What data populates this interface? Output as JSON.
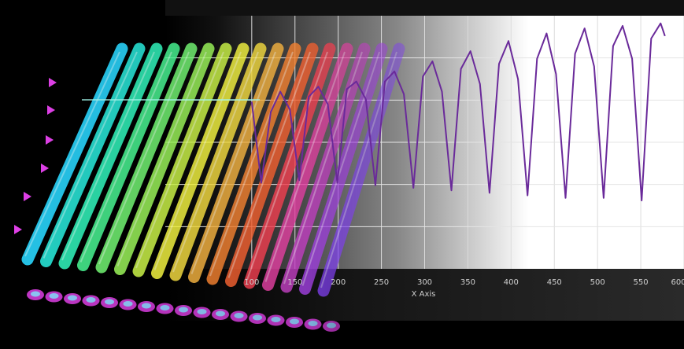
{
  "chart_data": {
    "type": "line",
    "xlabel": "X Axis",
    "xlim": [
      0,
      600
    ],
    "ylim": [
      0,
      1
    ],
    "grid": true,
    "x_ticks": [
      100,
      150,
      200,
      250,
      300,
      350,
      400,
      450,
      500,
      550,
      600
    ],
    "series": [
      {
        "color": "#6a2a9a",
        "x": [
          100,
          111,
          122,
          133,
          144,
          155,
          166,
          177,
          188,
          199,
          210,
          221,
          232,
          243,
          254,
          265,
          276,
          287,
          298,
          309,
          320,
          331,
          342,
          353,
          364,
          375,
          386,
          397,
          408,
          419,
          430,
          441,
          452,
          463,
          474,
          485,
          496,
          507,
          518,
          529,
          540,
          551,
          562,
          573,
          578
        ],
        "y": [
          0.66,
          0.34,
          0.62,
          0.7,
          0.63,
          0.35,
          0.68,
          0.72,
          0.65,
          0.34,
          0.71,
          0.74,
          0.67,
          0.33,
          0.74,
          0.78,
          0.69,
          0.32,
          0.76,
          0.82,
          0.7,
          0.31,
          0.79,
          0.86,
          0.73,
          0.3,
          0.81,
          0.9,
          0.75,
          0.29,
          0.83,
          0.93,
          0.77,
          0.28,
          0.85,
          0.95,
          0.8,
          0.28,
          0.88,
          0.96,
          0.83,
          0.27,
          0.91,
          0.97,
          0.92
        ]
      }
    ]
  },
  "decor": {
    "tubes": 17,
    "tube_colors": [
      "#2ad8ff",
      "#28e6d8",
      "#30f0b8",
      "#48f090",
      "#70f070",
      "#98f058",
      "#c8f048",
      "#f0f040",
      "#f0d840",
      "#f0b040",
      "#f08030",
      "#f06030",
      "#f04050",
      "#e040a0",
      "#c040c0",
      "#a040e0",
      "#8040f0"
    ]
  }
}
